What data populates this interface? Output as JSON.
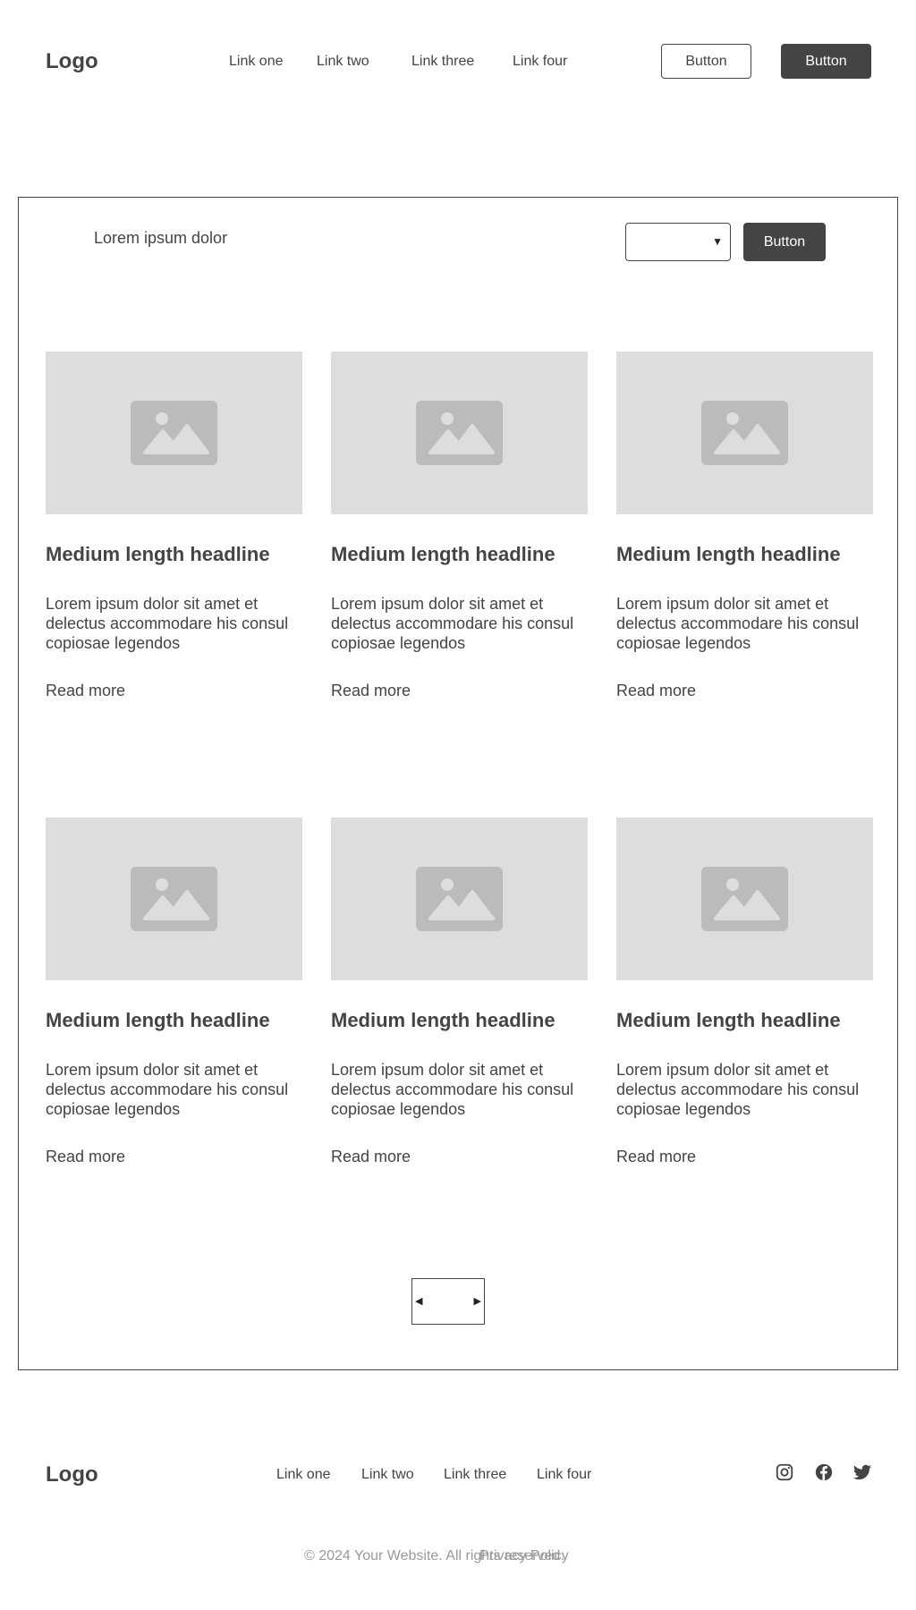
{
  "header": {
    "logo": "Logo",
    "nav": [
      "Link one",
      "Link two",
      "Link three",
      "Link four"
    ],
    "button_secondary": "Button",
    "button_primary": "Button"
  },
  "toolbar": {
    "label": "Lorem ipsum dolor",
    "select_value": "",
    "button": "Button"
  },
  "cards": [
    {
      "title": "Medium length headline",
      "text": "Lorem ipsum dolor sit amet et delectus accommodare his consul copiosae legendos",
      "link": "Read more"
    },
    {
      "title": "Medium length headline",
      "text": "Lorem ipsum dolor sit amet et delectus accommodare his consul copiosae legendos",
      "link": "Read more"
    },
    {
      "title": "Medium length headline",
      "text": "Lorem ipsum dolor sit amet et delectus accommodare his consul copiosae legendos",
      "link": "Read more"
    },
    {
      "title": "Medium length headline",
      "text": "Lorem ipsum dolor sit amet et delectus accommodare his consul copiosae legendos",
      "link": "Read more"
    },
    {
      "title": "Medium length headline",
      "text": "Lorem ipsum dolor sit amet et delectus accommodare his consul copiosae legendos",
      "link": "Read more"
    },
    {
      "title": "Medium length headline",
      "text": "Lorem ipsum dolor sit amet et delectus accommodare his consul copiosae legendos",
      "link": "Read more"
    }
  ],
  "pagination": {
    "prev_icon": "triangle-left",
    "next_icon": "triangle-right"
  },
  "footer": {
    "logo": "Logo",
    "nav": [
      "Link one",
      "Link two",
      "Link three",
      "Link four"
    ],
    "social": [
      "instagram-icon",
      "facebook-icon",
      "twitter-icon"
    ],
    "copyright": "© 2024 Your Website. All rights reserved.",
    "privacy": "Privacy Policy"
  },
  "colors": {
    "text": "#444444",
    "dark_button": "#444444",
    "placeholder_bg": "#dddddd",
    "placeholder_icon": "#bbbbbb",
    "muted": "#999999"
  }
}
